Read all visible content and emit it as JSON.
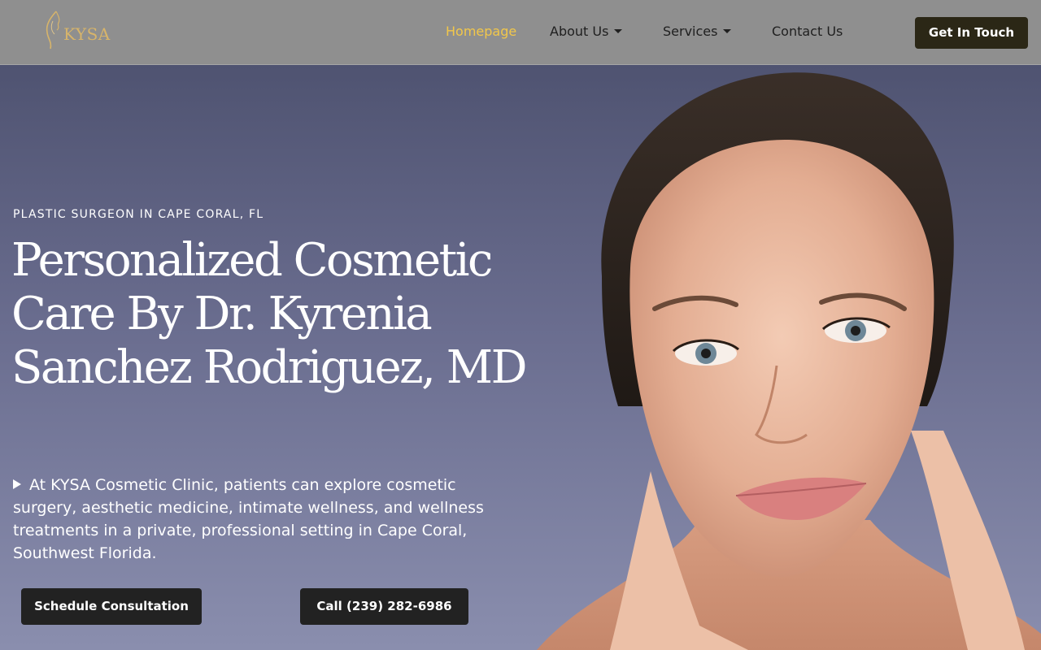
{
  "header": {
    "logo_text": "KYSA",
    "nav": [
      {
        "label": "Homepage"
      },
      {
        "label": "About Us"
      },
      {
        "label": "Services"
      },
      {
        "label": "Contact Us"
      }
    ],
    "cta_label": "Get In Touch"
  },
  "hero": {
    "eyebrow": "PLASTIC SURGEON IN CAPE CORAL, FL",
    "headline": "Personalized Cosmetic Care By Dr. Kyrenia Sanchez Rodriguez, MD",
    "intro": "At KYSA Cosmetic Clinic, patients can explore cosmetic surgery, aesthetic medicine, intimate wellness, and wellness treatments in a private, professional setting in Cape Coral, Southwest Florida.",
    "buttons": {
      "schedule": "Schedule Consultation",
      "call": "Call (239) 282-6986"
    }
  },
  "colors": {
    "header_bg": "#8f8f8f",
    "accent_gold": "#f2c74a",
    "logo_gold": "#d7b46a",
    "cta_bg": "#2b2716",
    "button_bg": "#222222",
    "hero_bg": "#6a6d8f"
  },
  "icons": {
    "logo_mark": "face-silhouette-icon",
    "dropdown": "caret-down-icon",
    "bullet": "play-triangle-icon"
  }
}
